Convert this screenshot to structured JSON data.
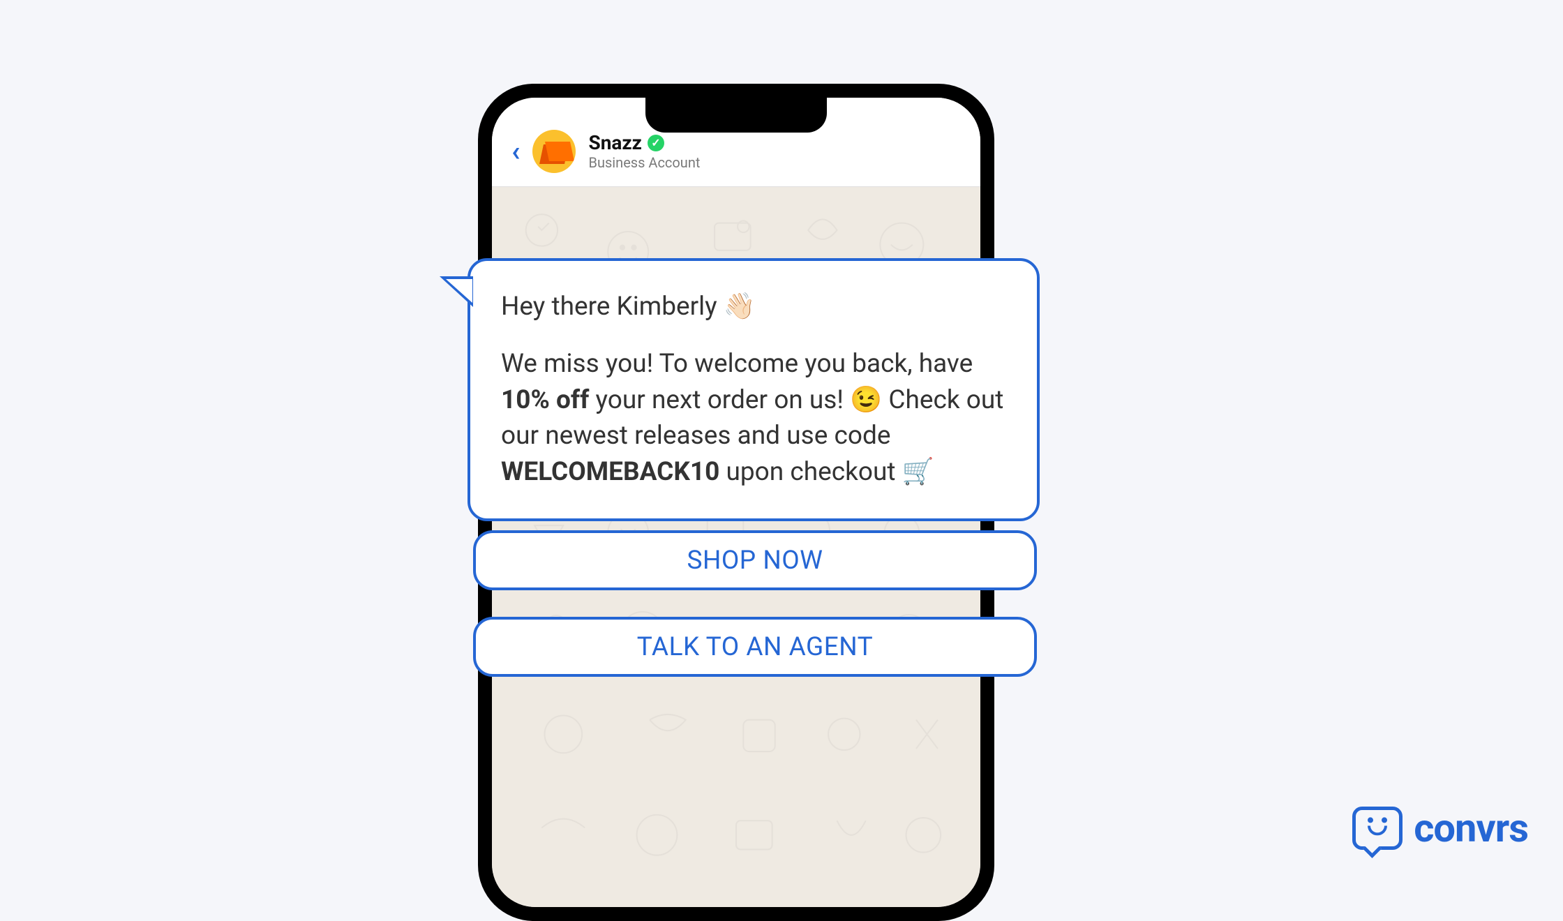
{
  "header": {
    "business_name": "Snazz",
    "business_subtitle": "Business Account",
    "verified_check": "✓"
  },
  "message": {
    "greeting_prefix": "Hey there Kimberly ",
    "greeting_emoji": "👋🏻",
    "body_prefix": "We miss you! To welcome you back, have ",
    "discount_bold": "10% off",
    "body_mid1": " your next order on us! ",
    "wink_emoji": "😉",
    "body_mid2": " Check out our newest releases and use code ",
    "code_bold": "WELCOMEBACK10",
    "body_suffix": " upon checkout ",
    "cart_emoji": "🛒"
  },
  "buttons": {
    "shop_now": "SHOP NOW",
    "talk_agent": "TALK TO AN AGENT"
  },
  "brand": {
    "logo_text": "convrs"
  },
  "colors": {
    "accent": "#2566d4",
    "bg": "#f5f6fa",
    "chat_bg": "#efeae2",
    "verified": "#25d366",
    "avatar": "#fbc02d"
  }
}
